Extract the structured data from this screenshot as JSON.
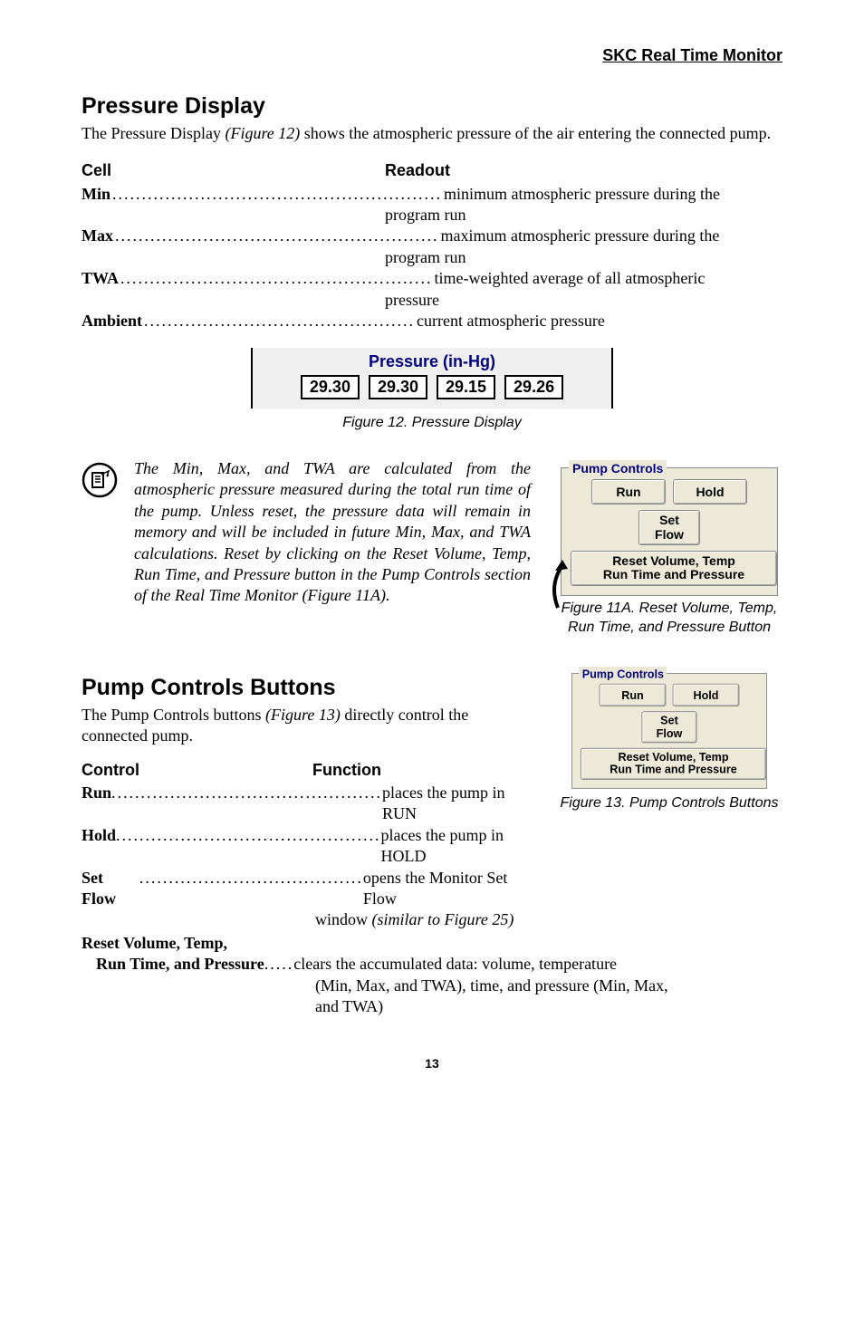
{
  "header": "SKC Real Time Monitor",
  "section1": {
    "title": "Pressure Display",
    "intro_a": "The Pressure Display ",
    "intro_b": "(Figure 12)",
    "intro_c": " shows the atmospheric pressure of the air entering the connected pump.",
    "headers": {
      "cell": "Cell",
      "readout": "Readout"
    },
    "rows": [
      {
        "label": "Min",
        "dots": "........................................................",
        "desc": "minimum atmospheric pressure during the",
        "cont": "program run"
      },
      {
        "label": "Max",
        "dots": ".......................................................",
        "desc": "maximum atmospheric pressure during the",
        "cont": "program run"
      },
      {
        "label": "TWA",
        "dots": ".....................................................",
        "desc": "time-weighted average of all atmospheric",
        "cont": "pressure"
      },
      {
        "label": "Ambient",
        "dots": "..............................................",
        "desc": "current atmospheric pressure"
      }
    ]
  },
  "fig12": {
    "title": "Pressure (in-Hg)",
    "cells": [
      "29.30",
      "29.30",
      "29.15",
      "29.26"
    ],
    "caption": "Figure 12. Pressure Display"
  },
  "note": "The Min, Max, and TWA are calculated from the atmospheric pressure measured during the total run time of the pump. Unless reset, the pressure data will remain in memory and will be included in future Min, Max, and TWA calculations. Reset by clicking on the Reset Volume, Temp, Run Time, and Pressure button in the Pump Controls section of the Real Time Monitor (Figure 11A).",
  "pump": {
    "legend": "Pump Controls",
    "run": "Run",
    "hold": "Hold",
    "setflow1": "Set",
    "setflow2": "Flow",
    "reset1": "Reset Volume, Temp",
    "reset2": "Run Time and Pressure"
  },
  "fig11a_caption": "Figure 11A. Reset Volume, Temp, Run Time, and Pressure Button",
  "section2": {
    "title": "Pump Controls Buttons",
    "intro_a": "The Pump Controls buttons ",
    "intro_b": "(Figure 13)",
    "intro_c": " directly control the connected pump.",
    "headers": {
      "control": "Control",
      "function": "Function"
    },
    "rows": [
      {
        "label": "Run",
        "dots": "..............................................",
        "desc": "places the pump in RUN"
      },
      {
        "label": "Hold",
        "dots": ".............................................",
        "desc": "places the pump in HOLD"
      },
      {
        "label": "Set Flow",
        "dots": "......................................",
        "desc": "opens the Monitor Set Flow"
      }
    ],
    "setflow_cont_a": "window ",
    "setflow_cont_b": "(similar to Figure 25)",
    "reset_head": "Reset Volume, Temp,",
    "reset_sub_label": "Run Time, and Pressure",
    "reset_dots": ".....",
    "reset_desc": "clears the accumulated data: volume, temperature",
    "reset_cont1": "(Min, Max, and TWA), time, and pressure  (Min, Max,",
    "reset_cont2": "and TWA)"
  },
  "fig13_caption": "Figure 13. Pump Controls Buttons",
  "page_num": "13"
}
